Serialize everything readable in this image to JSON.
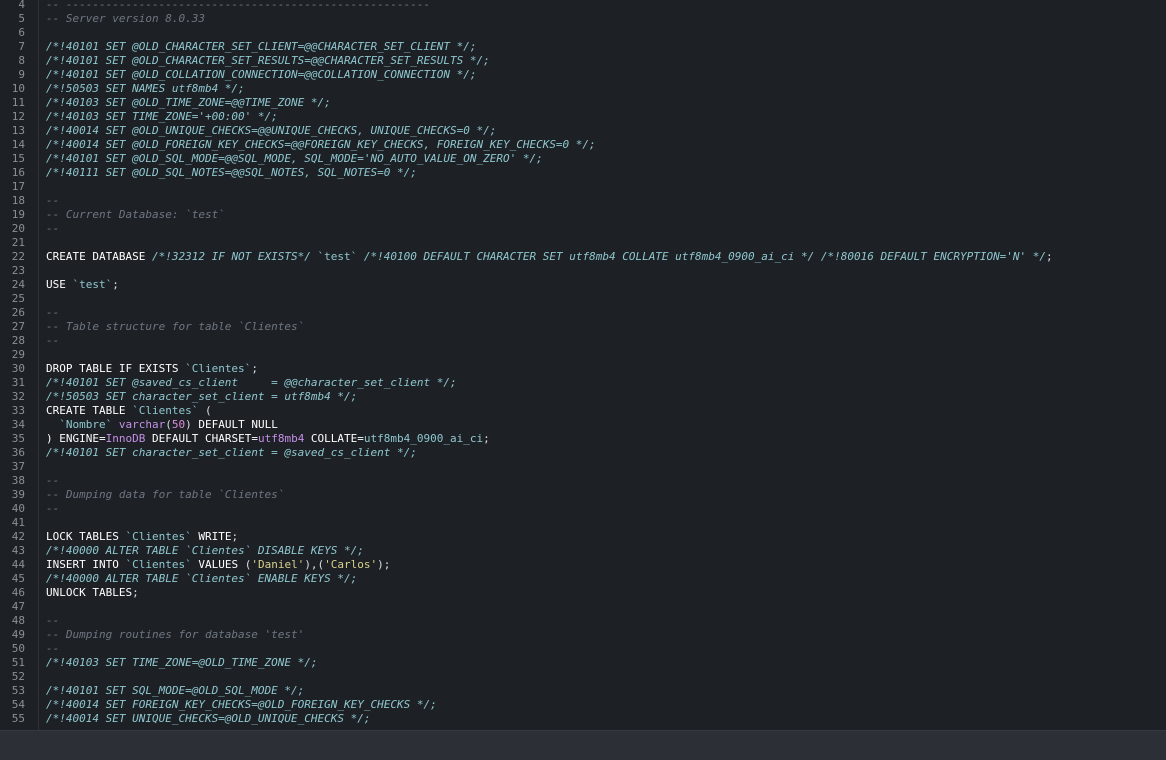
{
  "editor": {
    "lines": [
      {
        "n": "4",
        "tokens": [
          {
            "t": "-- -------------------------------------------------------",
            "c": "comment"
          }
        ]
      },
      {
        "n": "5",
        "tokens": [
          {
            "t": "-- Server version 8.0.33",
            "c": "comment"
          }
        ]
      },
      {
        "n": "6",
        "tokens": []
      },
      {
        "n": "7",
        "tokens": [
          {
            "t": "/*!40101 SET @OLD_CHARACTER_SET_CLIENT=@@CHARACTER_SET_CLIENT */;",
            "c": "directive"
          }
        ]
      },
      {
        "n": "8",
        "tokens": [
          {
            "t": "/*!40101 SET @OLD_CHARACTER_SET_RESULTS=@@CHARACTER_SET_RESULTS */;",
            "c": "directive"
          }
        ]
      },
      {
        "n": "9",
        "tokens": [
          {
            "t": "/*!40101 SET @OLD_COLLATION_CONNECTION=@@COLLATION_CONNECTION */;",
            "c": "directive"
          }
        ]
      },
      {
        "n": "10",
        "tokens": [
          {
            "t": "/*!50503 SET NAMES utf8mb4 */;",
            "c": "directive"
          }
        ]
      },
      {
        "n": "11",
        "tokens": [
          {
            "t": "/*!40103 SET @OLD_TIME_ZONE=@@TIME_ZONE */;",
            "c": "directive"
          }
        ]
      },
      {
        "n": "12",
        "tokens": [
          {
            "t": "/*!40103 SET TIME_ZONE='+00:00' */;",
            "c": "directive"
          }
        ]
      },
      {
        "n": "13",
        "tokens": [
          {
            "t": "/*!40014 SET @OLD_UNIQUE_CHECKS=@@UNIQUE_CHECKS, UNIQUE_CHECKS=0 */;",
            "c": "directive"
          }
        ]
      },
      {
        "n": "14",
        "tokens": [
          {
            "t": "/*!40014 SET @OLD_FOREIGN_KEY_CHECKS=@@FOREIGN_KEY_CHECKS, FOREIGN_KEY_CHECKS=0 */;",
            "c": "directive"
          }
        ]
      },
      {
        "n": "15",
        "tokens": [
          {
            "t": "/*!40101 SET @OLD_SQL_MODE=@@SQL_MODE, SQL_MODE='NO_AUTO_VALUE_ON_ZERO' */;",
            "c": "directive"
          }
        ]
      },
      {
        "n": "16",
        "tokens": [
          {
            "t": "/*!40111 SET @OLD_SQL_NOTES=@@SQL_NOTES, SQL_NOTES=0 */;",
            "c": "directive"
          }
        ]
      },
      {
        "n": "17",
        "tokens": []
      },
      {
        "n": "18",
        "tokens": [
          {
            "t": "--",
            "c": "comment"
          }
        ]
      },
      {
        "n": "19",
        "tokens": [
          {
            "t": "-- Current Database: `test`",
            "c": "comment"
          }
        ]
      },
      {
        "n": "20",
        "tokens": [
          {
            "t": "--",
            "c": "comment"
          }
        ]
      },
      {
        "n": "21",
        "tokens": []
      },
      {
        "n": "22",
        "tokens": [
          {
            "t": "CREATE DATABASE ",
            "c": "kw"
          },
          {
            "t": "/*!32312 IF NOT EXISTS*/ ",
            "c": "directive"
          },
          {
            "t": "`test`",
            "c": "ident"
          },
          {
            "t": " /*!40100 DEFAULT CHARACTER SET utf8mb4 COLLATE utf8mb4_0900_ai_ci */ /*!80016 DEFAULT ENCRYPTION='N' */",
            "c": "directive"
          },
          {
            "t": ";",
            "c": "plain"
          }
        ]
      },
      {
        "n": "23",
        "tokens": []
      },
      {
        "n": "24",
        "tokens": [
          {
            "t": "USE ",
            "c": "kw"
          },
          {
            "t": "`test`",
            "c": "ident"
          },
          {
            "t": ";",
            "c": "plain"
          }
        ]
      },
      {
        "n": "25",
        "tokens": []
      },
      {
        "n": "26",
        "tokens": [
          {
            "t": "--",
            "c": "comment"
          }
        ]
      },
      {
        "n": "27",
        "tokens": [
          {
            "t": "-- Table structure for table `Clientes`",
            "c": "comment"
          }
        ]
      },
      {
        "n": "28",
        "tokens": [
          {
            "t": "--",
            "c": "comment"
          }
        ]
      },
      {
        "n": "29",
        "tokens": []
      },
      {
        "n": "30",
        "tokens": [
          {
            "t": "DROP TABLE IF EXISTS ",
            "c": "kw"
          },
          {
            "t": "`Clientes`",
            "c": "ident"
          },
          {
            "t": ";",
            "c": "plain"
          }
        ]
      },
      {
        "n": "31",
        "tokens": [
          {
            "t": "/*!40101 SET @saved_cs_client     = @@character_set_client */;",
            "c": "directive"
          }
        ]
      },
      {
        "n": "32",
        "tokens": [
          {
            "t": "/*!50503 SET character_set_client = utf8mb4 */;",
            "c": "directive"
          }
        ]
      },
      {
        "n": "33",
        "tokens": [
          {
            "t": "CREATE TABLE ",
            "c": "kw"
          },
          {
            "t": "`Clientes`",
            "c": "ident"
          },
          {
            "t": " (",
            "c": "plain"
          }
        ]
      },
      {
        "n": "34",
        "tokens": [
          {
            "t": "  ",
            "c": "plain"
          },
          {
            "t": "`Nombre`",
            "c": "ident"
          },
          {
            "t": " ",
            "c": "plain"
          },
          {
            "t": "varchar",
            "c": "type"
          },
          {
            "t": "(",
            "c": "plain"
          },
          {
            "t": "50",
            "c": "num"
          },
          {
            "t": ") ",
            "c": "plain"
          },
          {
            "t": "DEFAULT NULL",
            "c": "kw"
          }
        ]
      },
      {
        "n": "35",
        "tokens": [
          {
            "t": ") ENGINE=",
            "c": "kw"
          },
          {
            "t": "InnoDB",
            "c": "type"
          },
          {
            "t": " DEFAULT CHARSET=",
            "c": "kw"
          },
          {
            "t": "utf8mb4",
            "c": "type"
          },
          {
            "t": " COLLATE=",
            "c": "kw"
          },
          {
            "t": "utf8mb4_0900_ai_ci",
            "c": "ident"
          },
          {
            "t": ";",
            "c": "plain"
          }
        ]
      },
      {
        "n": "36",
        "tokens": [
          {
            "t": "/*!40101 SET character_set_client = @saved_cs_client */;",
            "c": "directive"
          }
        ]
      },
      {
        "n": "37",
        "tokens": []
      },
      {
        "n": "38",
        "tokens": [
          {
            "t": "--",
            "c": "comment"
          }
        ]
      },
      {
        "n": "39",
        "tokens": [
          {
            "t": "-- Dumping data for table `Clientes`",
            "c": "comment"
          }
        ]
      },
      {
        "n": "40",
        "tokens": [
          {
            "t": "--",
            "c": "comment"
          }
        ]
      },
      {
        "n": "41",
        "tokens": []
      },
      {
        "n": "42",
        "tokens": [
          {
            "t": "LOCK TABLES ",
            "c": "kw"
          },
          {
            "t": "`Clientes`",
            "c": "ident"
          },
          {
            "t": " WRITE",
            "c": "kw"
          },
          {
            "t": ";",
            "c": "plain"
          }
        ]
      },
      {
        "n": "43",
        "tokens": [
          {
            "t": "/*!40000 ALTER TABLE `Clientes` DISABLE KEYS */;",
            "c": "directive"
          }
        ]
      },
      {
        "n": "44",
        "tokens": [
          {
            "t": "INSERT INTO ",
            "c": "kw"
          },
          {
            "t": "`Clientes`",
            "c": "ident"
          },
          {
            "t": " VALUES ",
            "c": "kw"
          },
          {
            "t": "(",
            "c": "plain"
          },
          {
            "t": "'Daniel'",
            "c": "str"
          },
          {
            "t": "),(",
            "c": "plain"
          },
          {
            "t": "'Carlos'",
            "c": "str"
          },
          {
            "t": ");",
            "c": "plain"
          }
        ]
      },
      {
        "n": "45",
        "tokens": [
          {
            "t": "/*!40000 ALTER TABLE `Clientes` ENABLE KEYS */;",
            "c": "directive"
          }
        ]
      },
      {
        "n": "46",
        "tokens": [
          {
            "t": "UNLOCK TABLES",
            "c": "kw"
          },
          {
            "t": ";",
            "c": "plain"
          }
        ]
      },
      {
        "n": "47",
        "tokens": []
      },
      {
        "n": "48",
        "tokens": [
          {
            "t": "--",
            "c": "comment"
          }
        ]
      },
      {
        "n": "49",
        "tokens": [
          {
            "t": "-- Dumping routines for database 'test'",
            "c": "comment"
          }
        ]
      },
      {
        "n": "50",
        "tokens": [
          {
            "t": "--",
            "c": "comment"
          }
        ]
      },
      {
        "n": "51",
        "tokens": [
          {
            "t": "/*!40103 SET TIME_ZONE=@OLD_TIME_ZONE */;",
            "c": "directive"
          }
        ]
      },
      {
        "n": "52",
        "tokens": []
      },
      {
        "n": "53",
        "tokens": [
          {
            "t": "/*!40101 SET SQL_MODE=@OLD_SQL_MODE */;",
            "c": "directive"
          }
        ]
      },
      {
        "n": "54",
        "tokens": [
          {
            "t": "/*!40014 SET FOREIGN_KEY_CHECKS=@OLD_FOREIGN_KEY_CHECKS */;",
            "c": "directive"
          }
        ]
      },
      {
        "n": "55",
        "tokens": [
          {
            "t": "/*!40014 SET UNIQUE_CHECKS=@OLD_UNIQUE_CHECKS */;",
            "c": "directive"
          }
        ]
      }
    ]
  },
  "statusbar": {
    "text": ""
  },
  "colors": {
    "background": "#1d2126",
    "comment": "#6f7680",
    "directive": "#8fc7cf",
    "keyword": "#ffffff",
    "identifier": "#8fc7cf",
    "string": "#d9d08a",
    "number": "#e08ad8",
    "type": "#c58ee6"
  }
}
